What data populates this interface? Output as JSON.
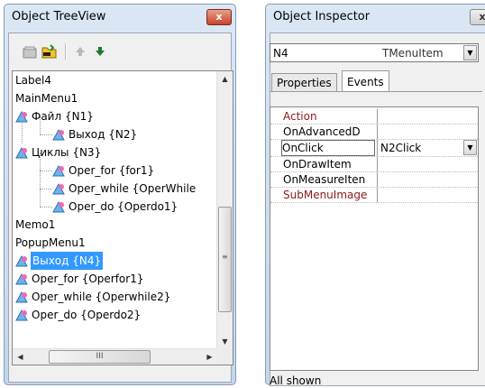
{
  "treeview": {
    "title": "Object TreeView",
    "close_glyph": "x",
    "nodes": [
      {
        "label": "Label4"
      },
      {
        "label": "MainMenu1"
      },
      {
        "label": "Файл {N1}"
      },
      {
        "label": "Выход {N2}"
      },
      {
        "label": "Циклы {N3}"
      },
      {
        "label": "Oper_for {for1}"
      },
      {
        "label": "Oper_while {OperWhile"
      },
      {
        "label": "Oper_do {Operdo1}"
      },
      {
        "label": "Memo1"
      },
      {
        "label": "PopupMenu1"
      },
      {
        "label": "Выход {N4}"
      },
      {
        "label": "Oper_for {Operfor1}"
      },
      {
        "label": "Oper_while {Operwhile2}"
      },
      {
        "label": "Oper_do {Operdo2}"
      }
    ],
    "hscroll_thumb_glyph": "III"
  },
  "inspector": {
    "title": "Object Inspector",
    "close_glyph": "x",
    "component_name": "N4",
    "component_type": "TMenuItem",
    "tabs": [
      "Properties",
      "Events"
    ],
    "active_tab": "Events",
    "rows": [
      {
        "name": "Action",
        "value": ""
      },
      {
        "name": "OnAdvancedD",
        "value": ""
      },
      {
        "name": "OnClick",
        "value": "N2Click"
      },
      {
        "name": "OnDrawItem",
        "value": ""
      },
      {
        "name": "OnMeasureIten",
        "value": ""
      },
      {
        "name": "SubMenuImage",
        "value": ""
      }
    ],
    "status": "All shown"
  },
  "colors": {
    "selection": "#3399ff",
    "event_red": "#8b1a1a",
    "window_frame": "#c6d6ea"
  }
}
